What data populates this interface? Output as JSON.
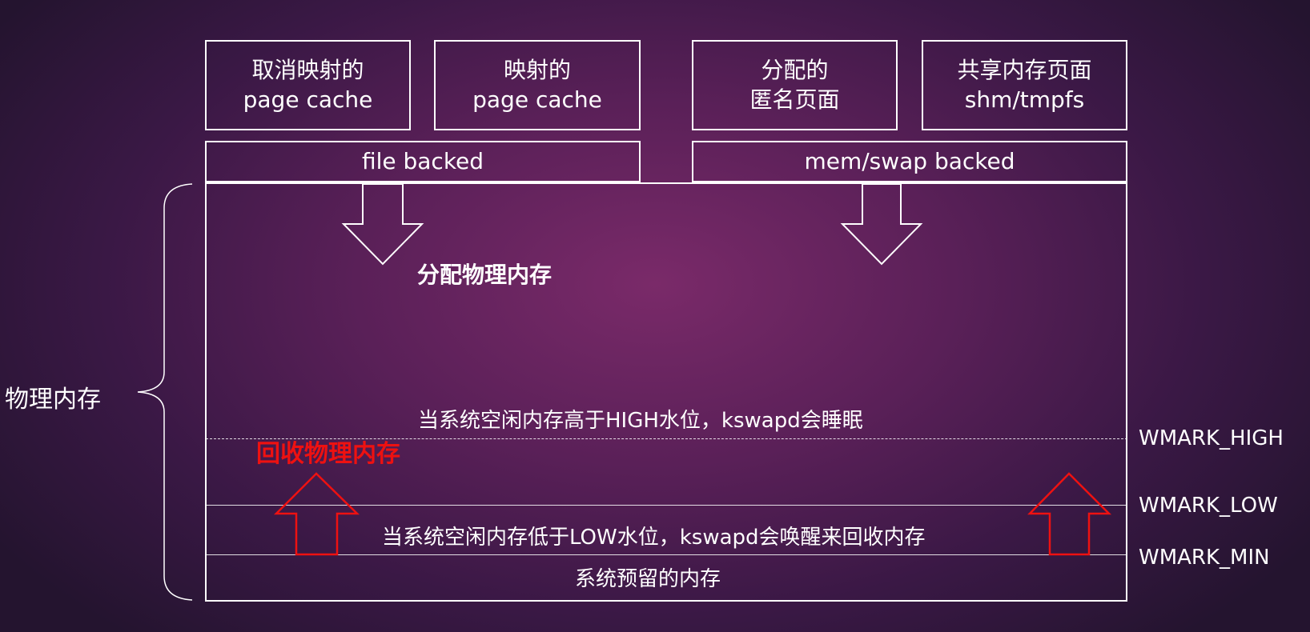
{
  "top_boxes": [
    {
      "line1": "取消映射的",
      "line2": "page cache"
    },
    {
      "line1": "映射的",
      "line2": "page cache"
    },
    {
      "line1": "分配的",
      "line2": "匿名页面"
    },
    {
      "line1": "共享内存页面",
      "line2": "shm/tmpfs"
    }
  ],
  "backing": {
    "file": "file backed",
    "mem": "mem/swap backed"
  },
  "physical_memory_label": "物理内存",
  "allocate_label": "分配物理内存",
  "reclaim_label": "回收物理内存",
  "high_note": "当系统空闲内存高于HIGH水位，kswapd会睡眠",
  "low_note": "当系统空闲内存低于LOW水位，kswapd会唤醒来回收内存",
  "reserved_note": "系统预留的内存",
  "watermarks": {
    "high": "WMARK_HIGH",
    "low": "WMARK_LOW",
    "min": "WMARK_MIN"
  },
  "colors": {
    "line": "#ffffff",
    "reclaim": "#ee1111"
  }
}
